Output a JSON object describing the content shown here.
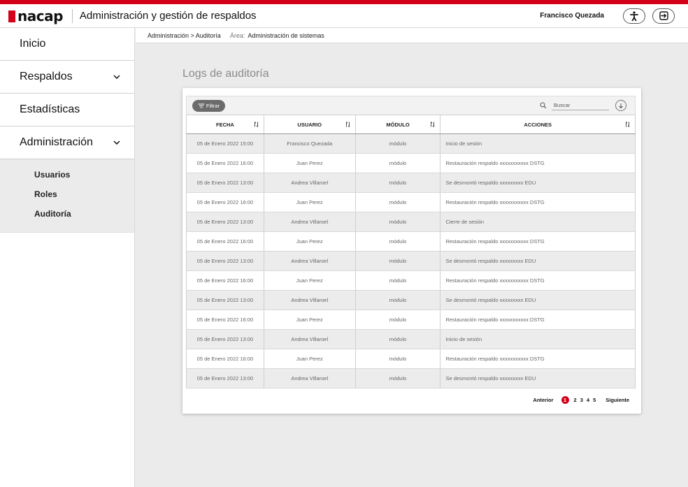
{
  "header": {
    "logo_text": "nacap",
    "app_title": "Administración y gestión de respaldos",
    "user_name": "Francisco Quezada",
    "accent_color": "#d4001a",
    "accessibility_icon": "accessibility-icon",
    "logout_icon": "logout-icon"
  },
  "sidebar": {
    "items": [
      {
        "label": "Inicio"
      },
      {
        "label": "Respaldos",
        "icon": "chevron-down-icon"
      },
      {
        "label": "Estadísticas"
      },
      {
        "label": "Administración",
        "icon": "chevron-down-icon"
      }
    ],
    "subitems": [
      {
        "label": "Usuarios"
      },
      {
        "label": "Roles"
      },
      {
        "label": "Auditoría"
      }
    ]
  },
  "breadcrumb": {
    "path": "Administración > Auditoría",
    "area_label": "Área:",
    "area_value": "Administración de sistemas"
  },
  "page": {
    "title": "Logs de auditoría"
  },
  "toolbar": {
    "filter_label": "Filtrar",
    "search_placeholder": "Buscar"
  },
  "table": {
    "columns": [
      "FECHA",
      "USUARIO",
      "MÓDULO",
      "ACCIONES"
    ],
    "rows": [
      {
        "fecha": "05 de Enero 2022 15:00",
        "usuario": "Francisco Quezada",
        "modulo": "módulo",
        "accion": "Inicio de sesión"
      },
      {
        "fecha": "05 de Enero 2022 16:00",
        "usuario": "Juan Perez",
        "modulo": "módulo",
        "accion": "Restauración respaldo xxxxxxxxxxx DSTG"
      },
      {
        "fecha": "05 de Enero 2022 13:00",
        "usuario": "Andrea Villaroel",
        "modulo": "módulo",
        "accion": "Se desmontó respaldo xxxxxxxxx EDU"
      },
      {
        "fecha": "05 de Enero 2022 16:00",
        "usuario": "Juan Perez",
        "modulo": "módulo",
        "accion": "Restauración respaldo xxxxxxxxxxx DSTG"
      },
      {
        "fecha": "05 de Enero 2022 13:00",
        "usuario": "Andrea Villaroel",
        "modulo": "módulo",
        "accion": "Cierre de sesión"
      },
      {
        "fecha": "05 de Enero 2022 16:00",
        "usuario": "Juan Perez",
        "modulo": "módulo",
        "accion": "Restauración respaldo xxxxxxxxxxx DSTG"
      },
      {
        "fecha": "05 de Enero 2022 13:00",
        "usuario": "Andrea Villaroel",
        "modulo": "módulo",
        "accion": "Se desmontó respaldo xxxxxxxxx EDU"
      },
      {
        "fecha": "05 de Enero 2022 16:00",
        "usuario": "Juan Perez",
        "modulo": "módulo",
        "accion": "Restauración respaldo xxxxxxxxxxx DSTG"
      },
      {
        "fecha": "05 de Enero 2022 13:00",
        "usuario": "Andrea Villaroel",
        "modulo": "módulo",
        "accion": "Se desmontó respaldo xxxxxxxxx EDU"
      },
      {
        "fecha": "05 de Enero 2022 16:00",
        "usuario": "Juan Perez",
        "modulo": "módulo",
        "accion": "Restauración respaldo xxxxxxxxxxx DSTG"
      },
      {
        "fecha": "05 de Enero 2022 13:00",
        "usuario": "Andrea Villaroel",
        "modulo": "módulo",
        "accion": "Inicio de sesión"
      },
      {
        "fecha": "05 de Enero 2022 16:00",
        "usuario": "Juan Perez",
        "modulo": "módulo",
        "accion": "Restauración respaldo xxxxxxxxxxx DSTG"
      },
      {
        "fecha": "05 de Enero 2022 13:00",
        "usuario": "Andrea Villaroel",
        "modulo": "módulo",
        "accion": "Se desmontó respaldo xxxxxxxxx EDU"
      }
    ]
  },
  "pagination": {
    "prev_label": "Anterior",
    "current": "1",
    "pages": [
      "2",
      "3",
      "4",
      "5"
    ],
    "next_label": "Siguiente"
  }
}
